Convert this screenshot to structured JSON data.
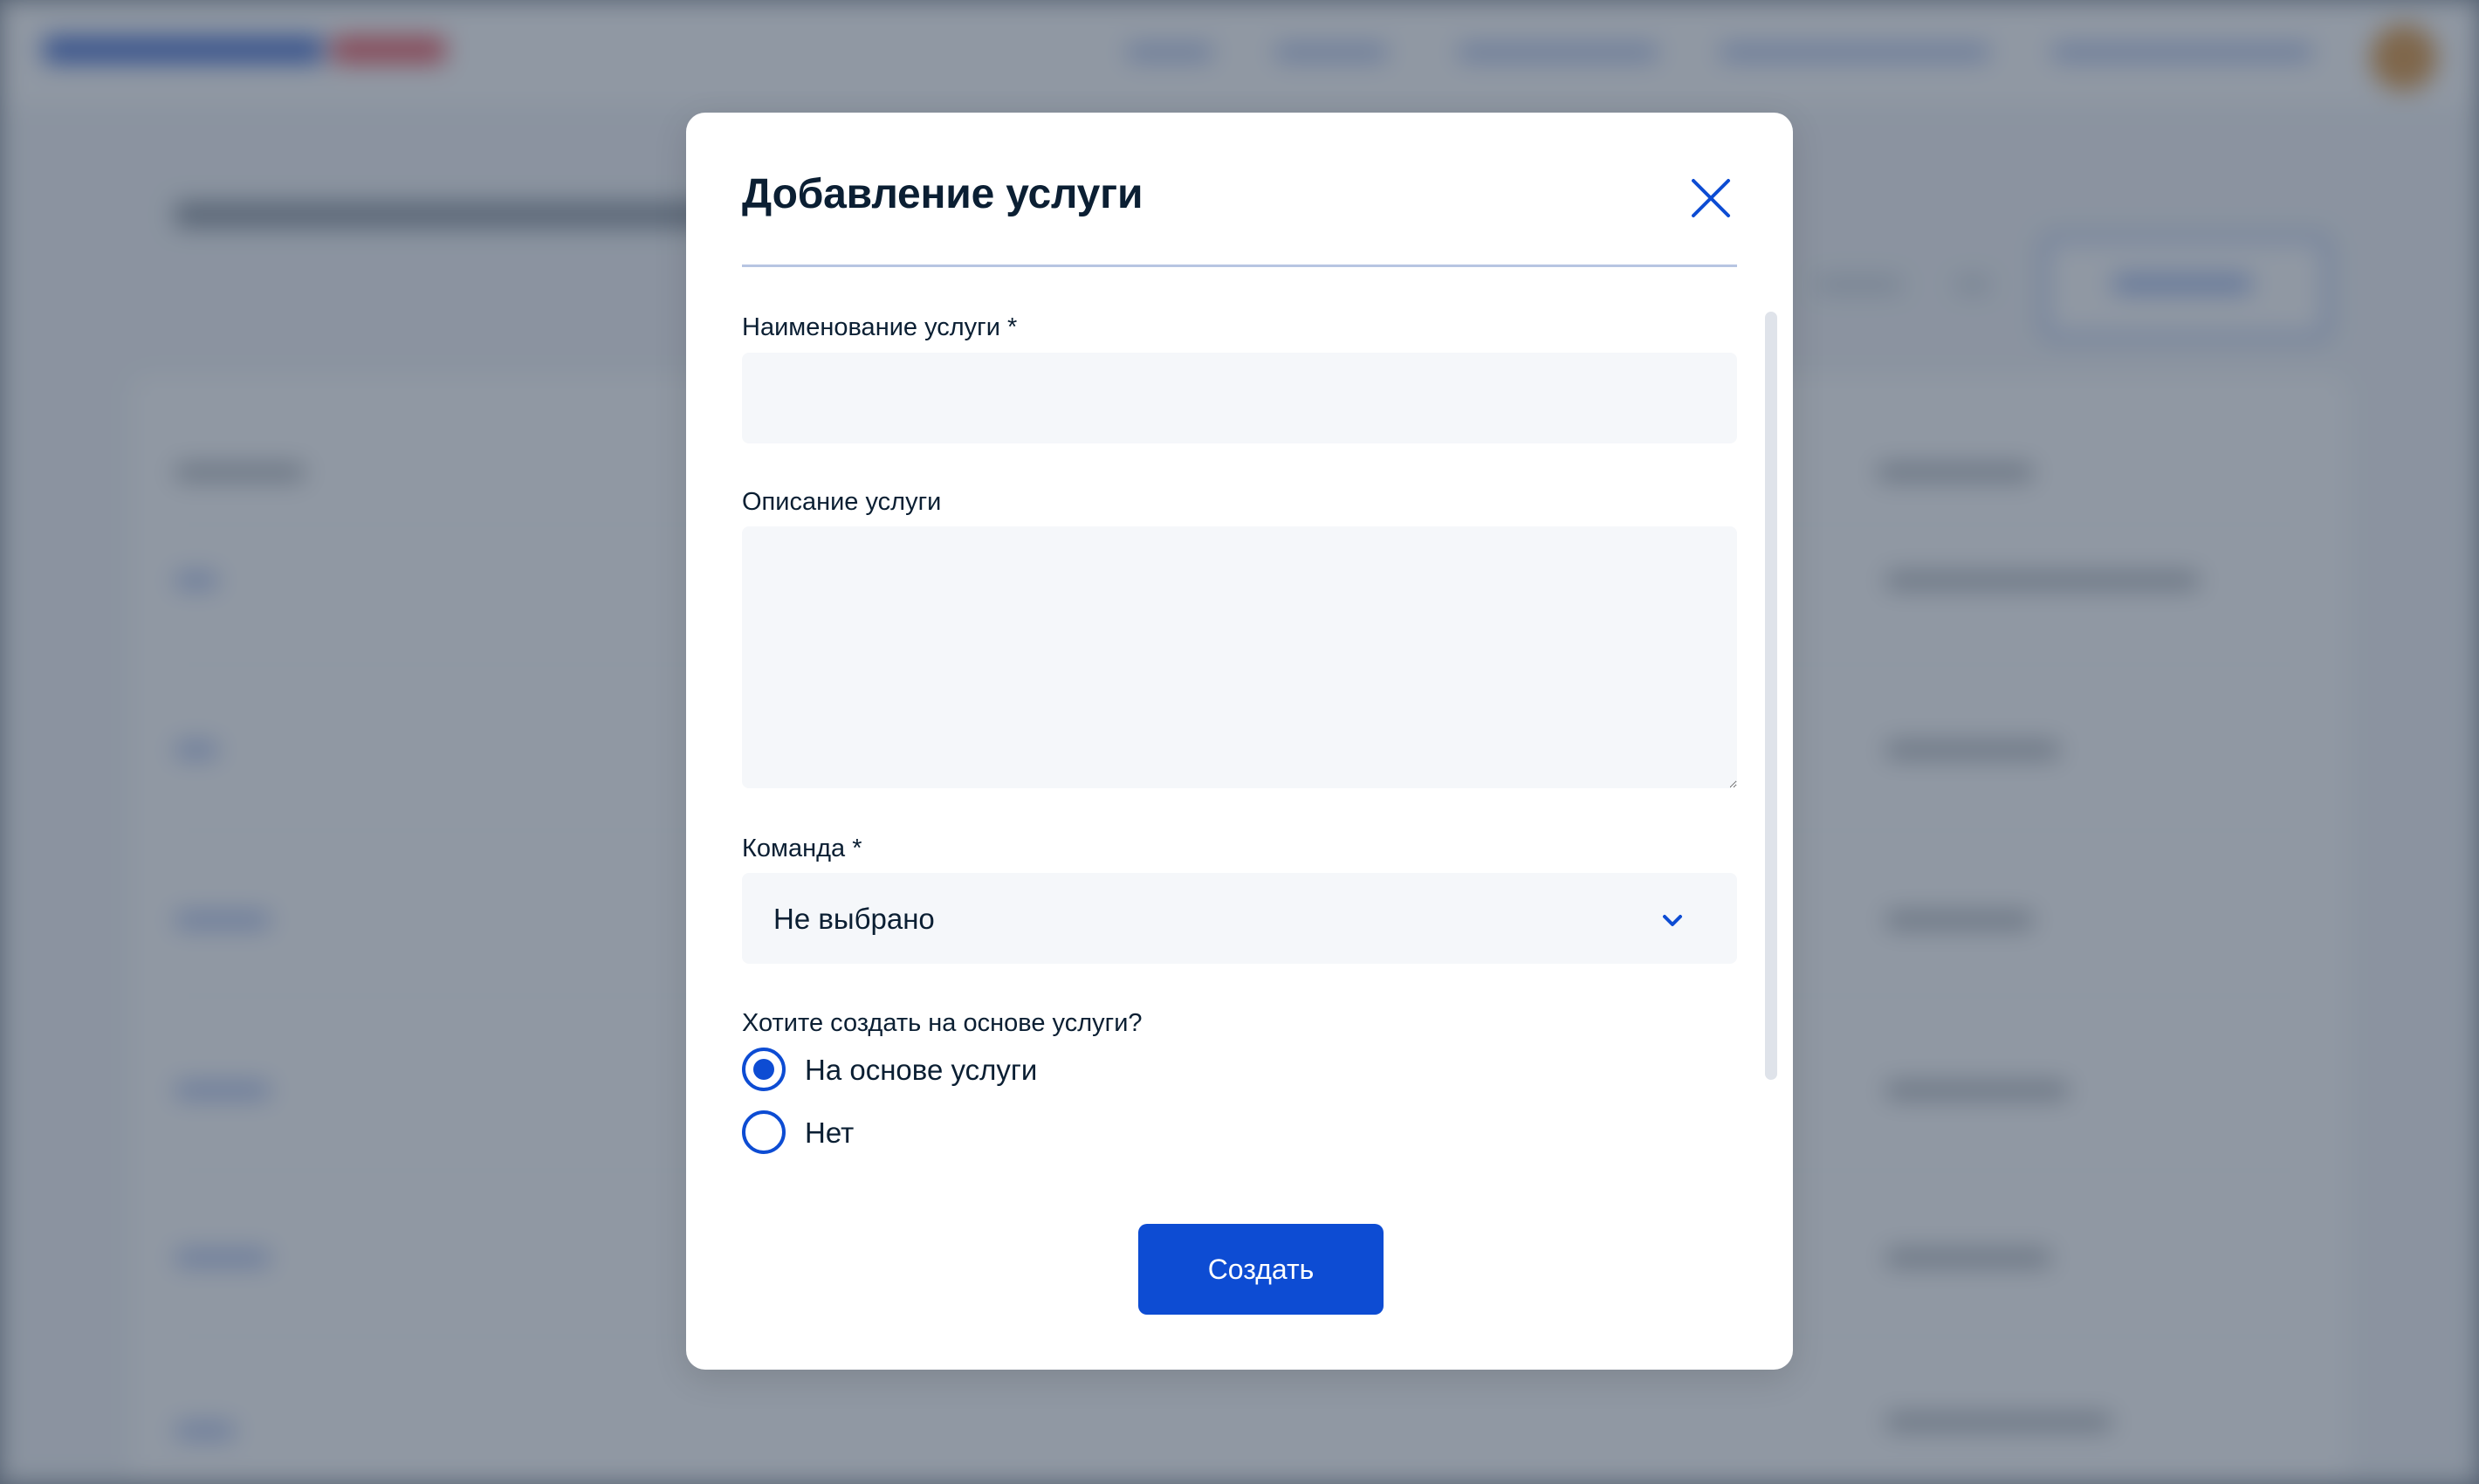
{
  "modal": {
    "title": "Добавление услуги",
    "fields": {
      "name": {
        "label": "Наименование услуги *",
        "value": "",
        "placeholder": ""
      },
      "description": {
        "label": "Описание услуги",
        "value": "",
        "placeholder": ""
      },
      "team": {
        "label": "Команда *",
        "selected": "Не выбрано"
      },
      "based_on": {
        "label": "Хотите создать на основе услуги?",
        "options": [
          {
            "label": "На основе услуги",
            "checked": true
          },
          {
            "label": "Нет",
            "checked": false
          }
        ]
      }
    },
    "submit_label": "Создать"
  },
  "icons": {
    "close": "close-icon",
    "select_arrow": "chevron-down-icon"
  },
  "colors": {
    "accent": "#0d4cd3",
    "text": "#0b1f33",
    "input_bg": "#f5f7fa",
    "divider": "#b7c5e2",
    "overlay": "#3f4e60"
  }
}
